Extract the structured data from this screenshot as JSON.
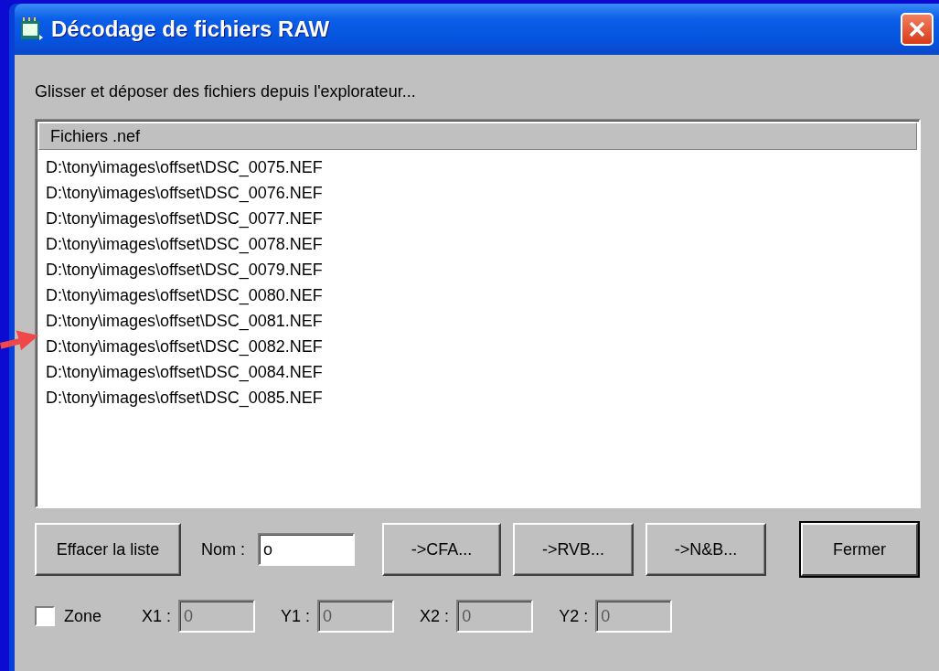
{
  "window": {
    "title": "Décodage de fichiers RAW"
  },
  "instruction": "Glisser et déposer des fichiers depuis l'explorateur...",
  "file_list": {
    "header": "Fichiers .nef",
    "rows": [
      "D:\\tony\\images\\offset\\DSC_0075.NEF",
      "D:\\tony\\images\\offset\\DSC_0076.NEF",
      "D:\\tony\\images\\offset\\DSC_0077.NEF",
      "D:\\tony\\images\\offset\\DSC_0078.NEF",
      "D:\\tony\\images\\offset\\DSC_0079.NEF",
      "D:\\tony\\images\\offset\\DSC_0080.NEF",
      "D:\\tony\\images\\offset\\DSC_0081.NEF",
      "D:\\tony\\images\\offset\\DSC_0082.NEF",
      "D:\\tony\\images\\offset\\DSC_0084.NEF",
      "D:\\tony\\images\\offset\\DSC_0085.NEF"
    ]
  },
  "actions": {
    "clear_button": "Effacer la liste",
    "name_label": "Nom :",
    "name_value": "o",
    "convert_buttons": [
      "->CFA...",
      "->RVB...",
      "->N&B..."
    ],
    "close_button": {
      "label": "Fermer",
      "default": true
    }
  },
  "zone": {
    "label": "Zone",
    "checked": false,
    "fields": [
      {
        "label": "X1 :",
        "value": "0",
        "disabled": true
      },
      {
        "label": "Y1 :",
        "value": "0",
        "disabled": true
      },
      {
        "label": "X2 :",
        "value": "0",
        "disabled": true
      },
      {
        "label": "Y2 :",
        "value": "0",
        "disabled": true
      }
    ]
  }
}
